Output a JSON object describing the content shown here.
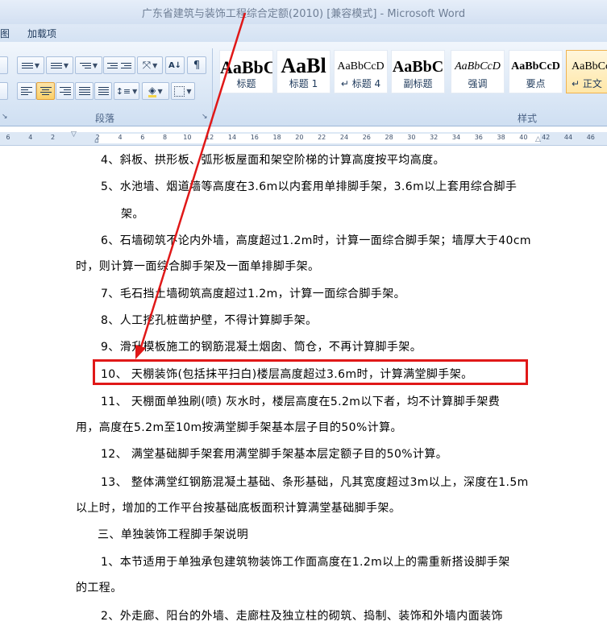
{
  "window": {
    "title": "广东省建筑与装饰工程综合定额(2010) [兼容模式] - Microsoft Word"
  },
  "tabs": [
    "图",
    "加载项"
  ],
  "ribbon": {
    "paragraph_group_label": "段落",
    "styles_group_label": "样式",
    "sort_icon_text": "A↓",
    "pilcrow_text": "¶",
    "styles": [
      {
        "sample": "AaBbC",
        "name": "标题"
      },
      {
        "sample": "AaBl",
        "name": "标题 1"
      },
      {
        "sample": "AaBbCcD",
        "name": "↵ 标题 4"
      },
      {
        "sample": "AaBbC",
        "name": "副标题"
      },
      {
        "sample": "AaBbCcD",
        "name": "强调"
      },
      {
        "sample": "AaBbCcD",
        "name": "要点"
      },
      {
        "sample": "AaBbCc",
        "name": "↵ 正文"
      }
    ]
  },
  "ruler": {
    "numbers": [
      "6",
      "4",
      "2",
      "",
      "2",
      "4",
      "6",
      "8",
      "10",
      "12",
      "14",
      "16",
      "18",
      "20",
      "22",
      "24",
      "26",
      "28",
      "30",
      "32",
      "34",
      "36",
      "38",
      "40",
      "42",
      "44",
      "46"
    ]
  },
  "document": {
    "lines": [
      "4、斜板、拱形板、弧形板屋面和架空阶梯的计算高度按平均高度。",
      "5、水池墙、烟道墙等高度在3.6m以内套用单排脚手架，3.6m以上套用综合脚手",
      "架。",
      "6、石墙砌筑不论内外墙，高度超过1.2m时，计算一面综合脚手架；墙厚大于40cm",
      "时，则计算一面综合脚手架及一面单排脚手架。",
      "7、毛石挡土墙砌筑高度超过1.2m，计算一面综合脚手架。",
      "8、人工挖孔桩凿护壁，不得计算脚手架。",
      "9、滑升模板施工的钢筋混凝土烟囱、筒仓，不再计算脚手架。",
      "10、 天棚装饰(包括抹平扫白)楼层高度超过3.6m时，计算满堂脚手架。",
      "11、 天棚面单独刷(喷) 灰水时，楼层高度在5.2m以下者，均不计算脚手架费",
      "用，高度在5.2m至10m按满堂脚手架基本层子目的50%计算。",
      "12、 满堂基础脚手架套用满堂脚手架基本层定额子目的50%计算。",
      "13、 整体满堂红钢筋混凝土基础、条形基础，凡其宽度超过3m以上，深度在1.5m",
      "以上时，增加的工作平台按基础底板面积计算满堂基础脚手架。",
      "三、单独装饰工程脚手架说明",
      "1、本节适用于单独承包建筑物装饰工作面高度在1.2m以上的需重新搭设脚手架",
      "的工程。",
      "2、外走廊、阳台的外墙、走廊柱及独立柱的砌筑、捣制、装饰和外墙内面装饰"
    ]
  },
  "annotation": {
    "box_color": "#e01818",
    "arrow_color": "#e01818"
  }
}
